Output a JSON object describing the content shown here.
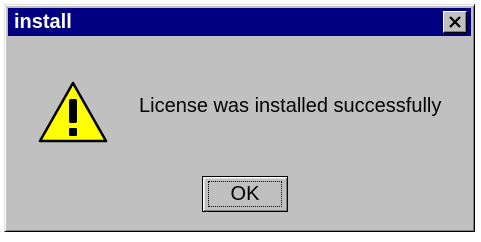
{
  "window": {
    "title": "install",
    "close_icon": "close-x-icon"
  },
  "dialog": {
    "icon": "warning-icon",
    "message": "License was installed successfully",
    "ok_label": "OK"
  },
  "colors": {
    "titlebar": "#000080",
    "title_text": "#ffffff",
    "face": "#c0c0c0",
    "warning_fill": "#ffff00"
  }
}
